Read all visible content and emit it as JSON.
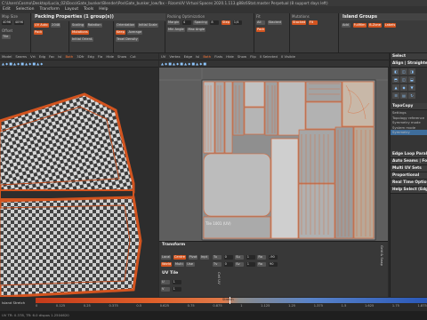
{
  "window": {
    "title": "C:\\Users\\Cosmo\\Desktop\\Lucia_02\\Doco\\Gate_bunker\\Blender\\Pos\\Gate_bunker_low.fbx - RizomUV  Virtual Spaces 2020.1.113.g88c6Stat.master Perpetual  (8 support days left)"
  },
  "menu": [
    "Edit",
    "Selection",
    "Transform",
    "Layout",
    "Tools",
    "Help"
  ],
  "toolbar": {
    "map_size_label": "Map Size",
    "map_size_value": "4096",
    "map_size_b": "4096",
    "packing_title": "Packing Properties (1 group(s))",
    "packing_note": "Margins",
    "scaling_label": "Scaling",
    "rotation_label": "Rotation",
    "orientation_label": "Orientation",
    "initial_scale": "Initial Scale",
    "initial_orient": "Initial Orient.",
    "keep_label": "Keep",
    "average_label": "Average",
    "mutations_label": "Mutations",
    "resolution_label": "Resolution",
    "resolution_value": "2048",
    "uv_auto_label": "UV Auto",
    "tex_density": "Texel Density",
    "margin_label": "Margin",
    "spacing_label": "Spacing",
    "margin_value": "4",
    "spacing_value": "8",
    "step_label": "Step",
    "step_value": "1/4",
    "min_angle": "Min Angle",
    "max_angle": "Max Angle",
    "packing_opt_label": "Packing Optimization",
    "island_groups_title": "Island Groups",
    "pack_button": "Pack",
    "fit_label": "Fit",
    "stacked_label": "Stacked",
    "all_label": "All",
    "offset_label": "Offset",
    "tile_label": "Tile",
    "groups_btn_a": "Fullfilm",
    "groups_btn_b": "B-Zone",
    "groups_btn_c": "Labels",
    "groups_btn_d": "Add"
  },
  "viewport3d_bar": [
    "Model",
    "Seams",
    "Vrt",
    "Edg",
    "Fac",
    "Isl",
    "Both",
    "3Dfr",
    "Edg",
    "Fla",
    "Hide",
    "Show",
    "Cut"
  ],
  "uv_bar": [
    "UV",
    "Vertex",
    "Edge",
    "Isl",
    "Both",
    "Flats",
    "Hide",
    "Show",
    "Flip"
  ],
  "uv_status": {
    "selected": "0 Selected",
    "visible": "0 Visible"
  },
  "tile_label": "Tile 1001 (UV)",
  "right_panel": {
    "select_header": "Select",
    "align_header": "Align | Straighten",
    "topocopy_header": "TopoCopy",
    "topo_items": [
      "Settings",
      "Topology reference",
      "Symmetry mode",
      "System mode",
      "Symmetry"
    ],
    "edge_loop": "Edge Loop Parallel",
    "auto_seams": "Auto Seams | Fold",
    "multi_uv": "Multi UV Sets",
    "proportional": "Proportional",
    "realtime": "Real Time Options",
    "help": "Help Select (Edge)"
  },
  "transform": {
    "header": "Transform",
    "mode_buttons": [
      "Local",
      "Centre",
      "Pivot",
      "Inpt"
    ],
    "row2": [
      "World",
      "Multi",
      "Use"
    ],
    "tu": "Tu",
    "tv": "Tv",
    "su": "Su",
    "sv": "Sv",
    "ro": "Ro",
    "val_tu": "0",
    "val_tv": "0",
    "val_su": "1",
    "val_sv": "1",
    "val_ro": "-90",
    "val_ro2": "90",
    "val_x": "0",
    "val_y": "0"
  },
  "uvtile": {
    "header": "UV Tile",
    "u_label": "U",
    "u_value": "1",
    "v_label": "V",
    "v_value": "1",
    "side_tab": "Grid & Snap",
    "side_tab2": "Cell UV"
  },
  "slider": {
    "label": "Island Stretch",
    "ticks": [
      "0",
      "0.125",
      "0.25",
      "0.375",
      "0.5",
      "0.625",
      "0.75",
      "0.875",
      "1",
      "1.125",
      "1.25",
      "1.375",
      "1.5",
      "1.625",
      "1.75",
      "1.875"
    ],
    "mark_label": "Stretch"
  },
  "status": "UV TR: 0.378, TR: 6.0 dispos 1.2504620",
  "colors": {
    "accent": "#d3541f",
    "uv_edge": "#e0602a",
    "background": "#2a2a2a"
  }
}
